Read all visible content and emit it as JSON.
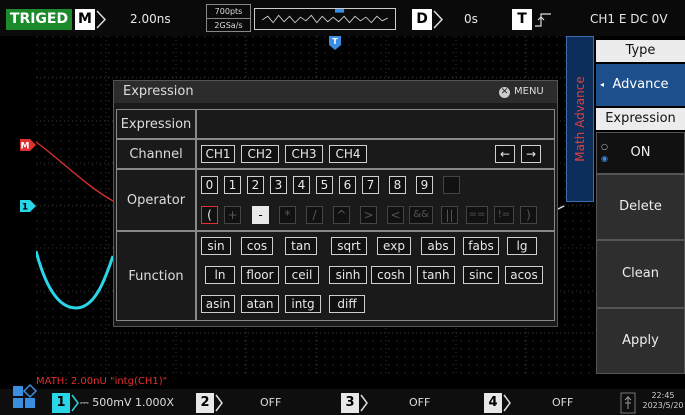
{
  "topbar": {
    "status": "TRIGED",
    "timebase_label": "M",
    "timebase": "2.00ns",
    "points": "700pts",
    "sample_rate": "2GSa/s",
    "delay_label": "D",
    "delay": "0s",
    "trigger_label": "T",
    "trigger_info": "CH1 E DC 0V"
  },
  "markers": {
    "trigger": "T",
    "math": "M",
    "ch1": "1"
  },
  "side_tab": "Math Advance",
  "right_menu": {
    "type_title": "Type",
    "type_value": "Advance",
    "expression_title": "Expression",
    "expression_value": "ON",
    "delete": "Delete",
    "clean": "Clean",
    "apply": "Apply"
  },
  "dialog": {
    "title": "Expression",
    "menu": "MENU",
    "expression_label": "Expression",
    "expression_value": "",
    "channel_label": "Channel",
    "channels": [
      "CH1",
      "CH2",
      "CH3",
      "CH4"
    ],
    "cursor_left": "←",
    "cursor_right": "→",
    "operator_label": "Operator",
    "digits": [
      "0",
      "1",
      "2",
      "3",
      "4",
      "5",
      "6",
      "7",
      "8",
      "9"
    ],
    "operators": [
      "(",
      "+",
      "-",
      "*",
      "/",
      "^",
      ">",
      "<",
      "&&",
      "||",
      "==",
      "!=",
      ")"
    ],
    "function_label": "Function",
    "functions_row1": [
      "sin",
      "cos",
      "tan",
      "sqrt",
      "exp",
      "abs",
      "fabs",
      "lg"
    ],
    "functions_row2": [
      "ln",
      "floor",
      "ceil",
      "sinh",
      "cosh",
      "tanh",
      "sinc",
      "acos"
    ],
    "functions_row3": [
      "asin",
      "atan",
      "intg",
      "diff"
    ]
  },
  "bottom": {
    "math_status": "MATH: 2.00nU \"intg(CH1)\"",
    "ch1_num": "1",
    "ch1_info": "500mV 1.000X",
    "ch2_num": "2",
    "ch2_info": "OFF",
    "ch3_num": "3",
    "ch3_info": "OFF",
    "ch4_num": "4",
    "ch4_info": "OFF",
    "time": "22:45",
    "date": "2023/5/20"
  },
  "colors": {
    "ch1": "#29d6e8",
    "math": "#e03030",
    "menu_select": "#1c4f8c",
    "trigger_badge": "#1a8a2a"
  }
}
